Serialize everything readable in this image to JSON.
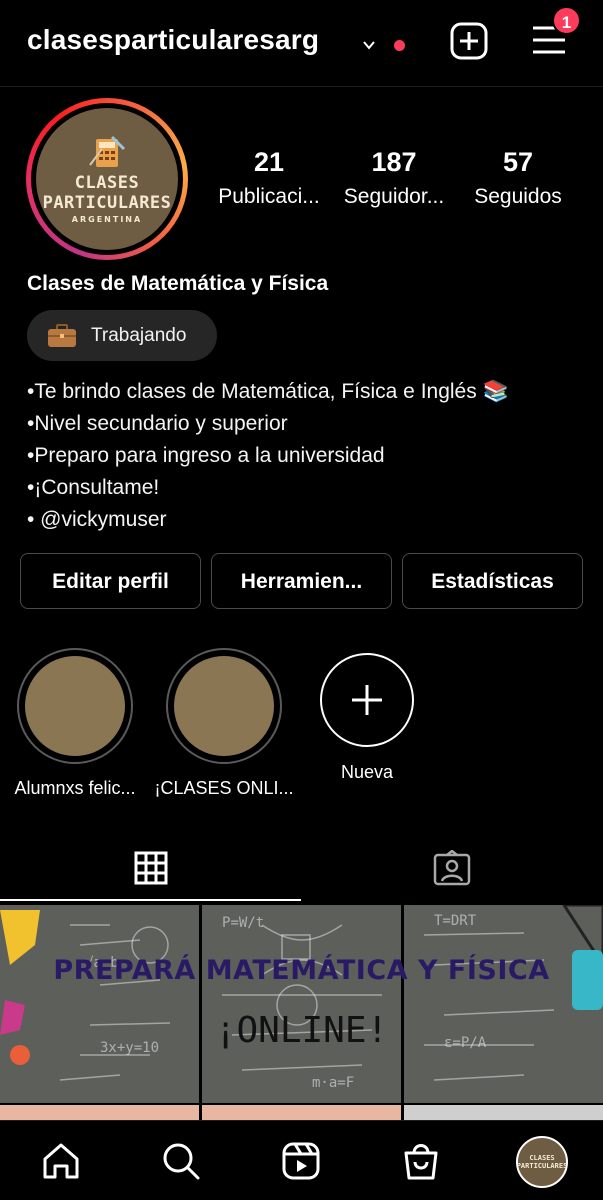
{
  "header": {
    "username": "clasesparticularesarg",
    "notification_count": "1"
  },
  "profile": {
    "avatar_text": [
      "CLASES",
      "PARTICULARES",
      "ARGENTINA"
    ],
    "stats": [
      {
        "value": "21",
        "label": "Publicaci..."
      },
      {
        "value": "187",
        "label": "Seguidor..."
      },
      {
        "value": "57",
        "label": "Seguidos"
      }
    ],
    "full_name": "Clases de Matemática y Física",
    "status": "Trabajando",
    "bio": [
      "•Te brindo clases de Matemática, Física e Inglés 📚",
      "•Nivel secundario y superior",
      "•Preparo para ingreso a la universidad",
      "•¡Consultame!",
      "• @vickymuser"
    ]
  },
  "actions": {
    "edit_profile": "Editar perfil",
    "tools": "Herramien...",
    "insights": "Estadísticas"
  },
  "highlights": [
    {
      "label": "Alumnxs felic..."
    },
    {
      "label": "¡CLASES ONLI..."
    }
  ],
  "new_highlight_label": "Nueva",
  "post_banner": {
    "line1": "PREPARÁ MATEMÁTICA Y FÍSICA",
    "line2": "¡ONLINE!"
  },
  "colors": {
    "background": "#000000",
    "accent_red": "#ff3b5c",
    "pill_bg": "#262626",
    "brand_brown": "#6e5c43"
  },
  "icons": {
    "header": [
      "chevron-down-icon",
      "plus-square-icon",
      "menu-icon"
    ],
    "tabs": [
      "grid-icon",
      "tagged-icon"
    ],
    "nav": [
      "home-icon",
      "search-icon",
      "reels-icon",
      "shop-icon",
      "profile-avatar"
    ]
  }
}
